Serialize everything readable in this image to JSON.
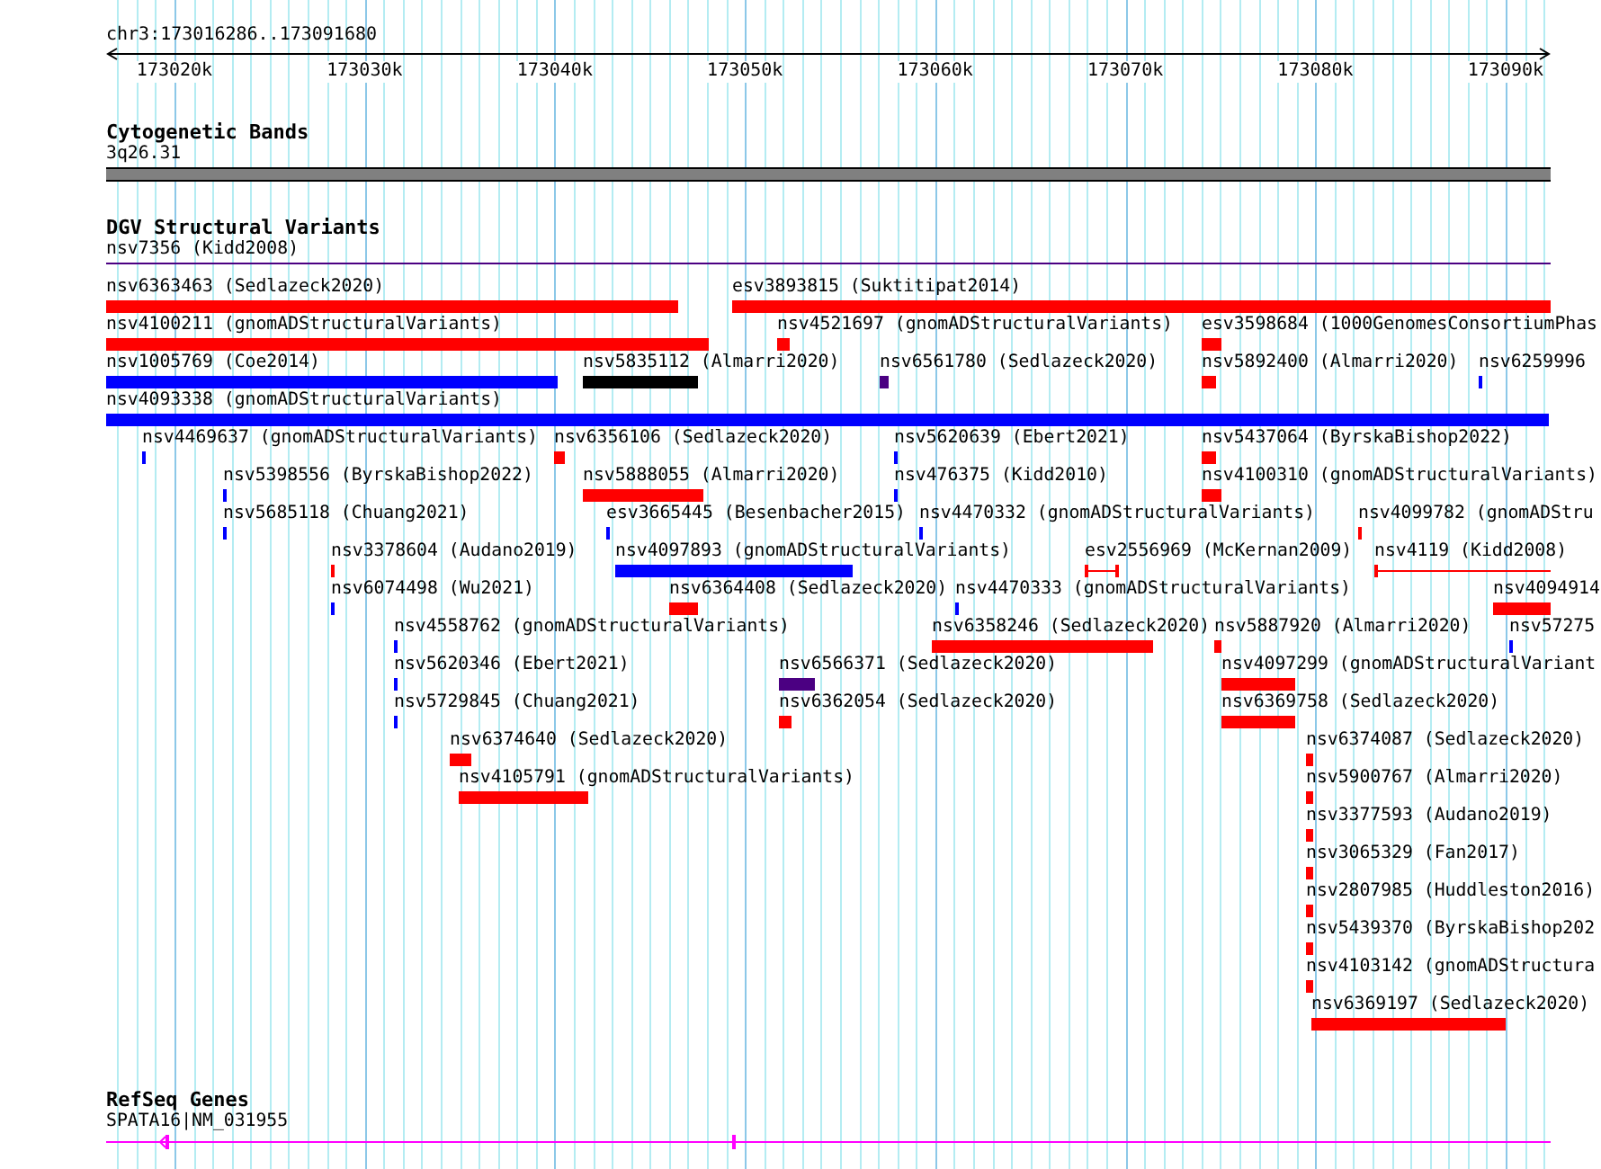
{
  "location": "chr3:173016286..173091680",
  "axis": {
    "ticks": [
      "173020k",
      "173030k",
      "173040k",
      "173050k",
      "173060k",
      "173070k",
      "173080k",
      "173090k"
    ]
  },
  "tracks": [
    {
      "kind": "bands",
      "title": "Cytogenetic Bands",
      "features": [
        {
          "label": "3q26.31"
        }
      ]
    },
    {
      "kind": "variants",
      "title": "DGV Structural Variants",
      "rows": [
        [
          {
            "kind": "thin",
            "label": "nsv7356 (Kidd2008)",
            "color": "#4b0082"
          }
        ],
        [
          {
            "kind": "bar",
            "label": "nsv6363463 (Sedlazeck2020)",
            "color": "#ff0000"
          },
          {
            "kind": "bar",
            "label": "esv3893815 (Suktitipat2014)",
            "color": "#ff0000"
          }
        ],
        [
          {
            "kind": "bar",
            "label": "nsv4100211 (gnomADStructuralVariants)",
            "color": "#ff0000"
          },
          {
            "kind": "bar",
            "label": "nsv4521697 (gnomADStructuralVariants)",
            "color": "#ff0000"
          },
          {
            "kind": "bar",
            "label": "esv3598684 (1000GenomesConsortiumPhas",
            "color": "#ff0000"
          }
        ],
        [
          {
            "kind": "bar",
            "label": "nsv1005769 (Coe2014)",
            "color": "#0000ff"
          },
          {
            "kind": "bar",
            "label": "nsv5835112 (Almarri2020)",
            "color": "#000000"
          },
          {
            "kind": "bar",
            "label": "nsv6561780 (Sedlazeck2020)",
            "color": "#4b0082"
          },
          {
            "kind": "bar",
            "label": "nsv5892400 (Almarri2020)",
            "color": "#ff0000"
          },
          {
            "kind": "bar",
            "label": "nsv6259996",
            "color": "#0000ff"
          }
        ],
        [
          {
            "kind": "bar",
            "label": "nsv4093338 (gnomADStructuralVariants)",
            "color": "#0000ff"
          }
        ],
        [
          {
            "kind": "bar",
            "label": "nsv4469637 (gnomADStructuralVariants)",
            "color": "#0000ff"
          },
          {
            "kind": "bar",
            "label": "nsv6356106 (Sedlazeck2020)",
            "color": "#ff0000"
          },
          {
            "kind": "bar",
            "label": "nsv5620639 (Ebert2021)",
            "color": "#0000ff"
          },
          {
            "kind": "bar",
            "label": "nsv5437064 (ByrskaBishop2022)",
            "color": "#ff0000"
          }
        ],
        [
          {
            "kind": "bar",
            "label": "nsv5398556 (ByrskaBishop2022)",
            "color": "#0000ff"
          },
          {
            "kind": "bar",
            "label": "nsv5888055 (Almarri2020)",
            "color": "#ff0000"
          },
          {
            "kind": "bar",
            "label": "nsv476375 (Kidd2010)",
            "color": "#0000ff"
          },
          {
            "kind": "bar",
            "label": "nsv4100310 (gnomADStructuralVariants)",
            "color": "#ff0000"
          }
        ],
        [
          {
            "kind": "bar",
            "label": "nsv5685118 (Chuang2021)",
            "color": "#0000ff"
          },
          {
            "kind": "bar",
            "label": "esv3665445 (Besenbacher2015)",
            "color": "#0000ff"
          },
          {
            "kind": "bar",
            "label": "nsv4470332 (gnomADStructuralVariants)",
            "color": "#0000ff"
          },
          {
            "kind": "bar",
            "label": "nsv4099782 (gnomADStru",
            "color": "#ff0000"
          }
        ],
        [
          {
            "kind": "bar",
            "label": "nsv3378604 (Audano2019)",
            "color": "#ff0000"
          },
          {
            "kind": "bar",
            "label": "nsv4097893 (gnomADStructuralVariants)",
            "color": "#0000ff"
          },
          {
            "kind": "span",
            "label": "esv2556969 (McKernan2009)",
            "color": "#ff0000"
          },
          {
            "kind": "span",
            "label": "nsv4119 (Kidd2008)",
            "color": "#ff0000"
          }
        ],
        [
          {
            "kind": "bar",
            "label": "nsv6074498 (Wu2021)",
            "color": "#0000ff"
          },
          {
            "kind": "bar",
            "label": "nsv6364408 (Sedlazeck2020)",
            "color": "#ff0000"
          },
          {
            "kind": "bar",
            "label": "nsv4470333 (gnomADStructuralVariants)",
            "color": "#0000ff"
          },
          {
            "kind": "bar",
            "label": "nsv4094914",
            "color": "#ff0000"
          }
        ],
        [
          {
            "kind": "bar",
            "label": "nsv4558762 (gnomADStructuralVariants)",
            "color": "#0000ff"
          },
          {
            "kind": "bar",
            "label": "nsv6358246 (Sedlazeck2020)",
            "color": "#ff0000"
          },
          {
            "kind": "bar",
            "label": "nsv5887920 (Almarri2020)",
            "color": "#ff0000"
          },
          {
            "kind": "bar",
            "label": "nsv57275",
            "color": "#0000ff"
          }
        ],
        [
          {
            "kind": "bar",
            "label": "nsv5620346 (Ebert2021)",
            "color": "#0000ff"
          },
          {
            "kind": "bar",
            "label": "nsv6566371 (Sedlazeck2020)",
            "color": "#4b0082"
          },
          {
            "kind": "bar",
            "label": "nsv4097299 (gnomADStructuralVariant",
            "color": "#ff0000"
          }
        ],
        [
          {
            "kind": "bar",
            "label": "nsv5729845 (Chuang2021)",
            "color": "#0000ff"
          },
          {
            "kind": "bar",
            "label": "nsv6362054 (Sedlazeck2020)",
            "color": "#ff0000"
          },
          {
            "kind": "bar",
            "label": "nsv6369758 (Sedlazeck2020)",
            "color": "#ff0000"
          }
        ],
        [
          {
            "kind": "bar",
            "label": "nsv6374640 (Sedlazeck2020)",
            "color": "#ff0000"
          },
          {
            "kind": "bar",
            "label": "nsv6374087 (Sedlazeck2020)",
            "color": "#ff0000"
          }
        ],
        [
          {
            "kind": "bar",
            "label": "nsv4105791 (gnomADStructuralVariants)",
            "color": "#ff0000"
          },
          {
            "kind": "bar",
            "label": "nsv5900767 (Almarri2020)",
            "color": "#ff0000"
          }
        ],
        [
          {
            "kind": "bar",
            "label": "nsv3377593 (Audano2019)",
            "color": "#ff0000"
          }
        ],
        [
          {
            "kind": "bar",
            "label": "nsv3065329 (Fan2017)",
            "color": "#ff0000"
          }
        ],
        [
          {
            "kind": "bar",
            "label": "nsv2807985 (Huddleston2016)",
            "color": "#ff0000"
          }
        ],
        [
          {
            "kind": "bar",
            "label": "nsv5439370 (ByrskaBishop202",
            "color": "#ff0000"
          }
        ],
        [
          {
            "kind": "bar",
            "label": "nsv4103142 (gnomADStructura",
            "color": "#ff0000"
          }
        ],
        [
          {
            "kind": "bar",
            "label": "nsv6369197 (Sedlazeck2020)",
            "color": "#ff0000"
          }
        ]
      ]
    },
    {
      "kind": "genes",
      "title": "RefSeq Genes",
      "features": [
        {
          "label": "SPATA16|NM_031955"
        }
      ]
    }
  ]
}
